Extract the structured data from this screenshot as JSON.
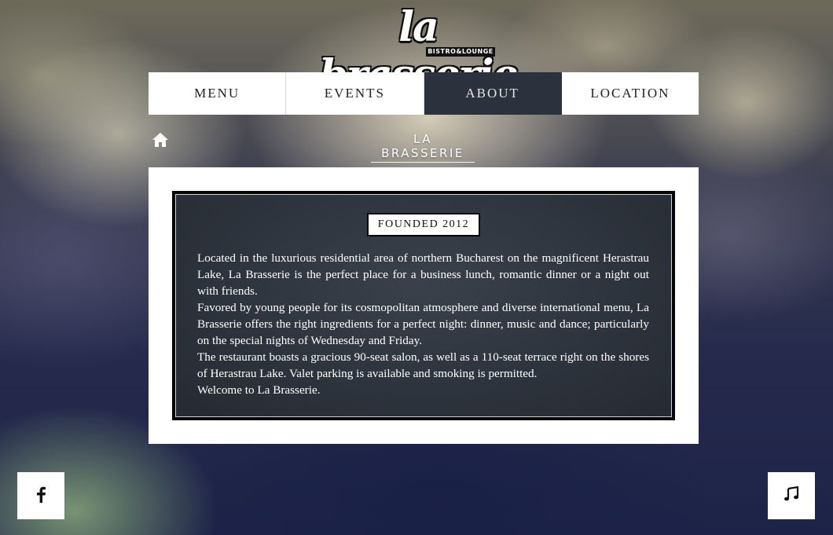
{
  "brand": {
    "logo_text": "la brasserie",
    "logo_subtitle": "BISTRO&LOUNGE"
  },
  "nav": {
    "items": [
      {
        "label": "MENU",
        "active": false
      },
      {
        "label": "EVENTS",
        "active": false
      },
      {
        "label": "ABOUT",
        "active": true
      },
      {
        "label": "LOCATION",
        "active": false
      }
    ]
  },
  "breadcrumb": {
    "home_icon": "home-icon",
    "current": "LA BRASSERIE"
  },
  "about": {
    "badge": "FOUNDED 2012",
    "paragraphs": [
      "Located in the luxurious residential area of northern Bucharest on the magnificent Herastrau Lake, La Brasserie is the perfect place for a business lunch, romantic dinner or a night out with friends.",
      "Favored by young people for its cosmopolitan atmosphere and diverse international menu, La Brasserie offers the right ingredients for a perfect night: dinner, music and dance; particularly on the special nights of Wednesday and Friday.",
      "The restaurant boasts a gracious 90-seat salon, as well as a 110-seat terrace right on the shores of Herastrau Lake. Valet parking is available and smoking is permitted.",
      "Welcome to La Brasserie."
    ]
  },
  "social": {
    "facebook_icon": "facebook-icon",
    "music_icon": "music-note-icon"
  },
  "colors": {
    "nav_active_bg": "#2b323d",
    "panel_bg": "#2d333c",
    "card_bg": "#ffffff",
    "text_light": "#ffffff"
  }
}
